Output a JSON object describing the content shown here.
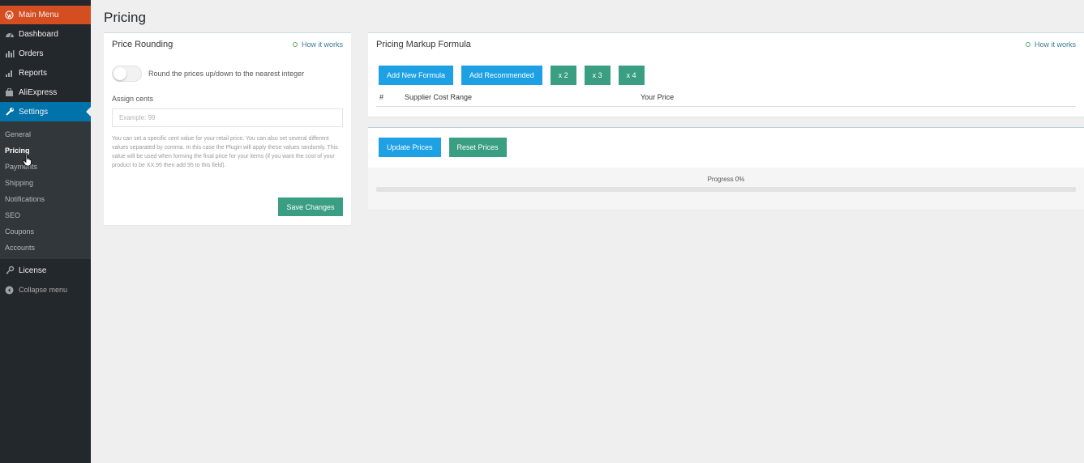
{
  "sidebar": {
    "main_menu": "Main Menu",
    "items": [
      {
        "label": "Dashboard",
        "icon": "dashboard-icon"
      },
      {
        "label": "Orders",
        "icon": "orders-icon"
      },
      {
        "label": "Reports",
        "icon": "reports-icon"
      },
      {
        "label": "AliExpress",
        "icon": "aliexpress-icon"
      },
      {
        "label": "Settings",
        "icon": "wrench-icon"
      }
    ],
    "submenu": [
      "General",
      "Pricing",
      "Payments",
      "Shipping",
      "Notifications",
      "SEO",
      "Coupons",
      "Accounts"
    ],
    "license": "License",
    "collapse": "Collapse menu"
  },
  "page": {
    "title": "Pricing"
  },
  "rounding": {
    "title": "Price Rounding",
    "how_it_works": "How it works",
    "toggle_label": "Round the prices up/down to the nearest integer",
    "assign_label": "Assign cents",
    "cents_placeholder": "Example: 99",
    "help_text": "You can set a specific cent value for your retail price. You can also set several different values separated by comma. In this case the Plugin will apply these values randomly. This value will be used when forming the final price for your items (if you want the cost of your product to be XX.95 then add 95 to this field).",
    "save_label": "Save Changes"
  },
  "markup": {
    "title": "Pricing Markup Formula",
    "how_it_works": "How it works",
    "buttons": {
      "add_new": "Add New Formula",
      "add_recommended": "Add Recommended",
      "x2": "x 2",
      "x3": "x 3",
      "x4": "x 4"
    },
    "columns": [
      "#",
      "Supplier Cost Range",
      "Your Price"
    ]
  },
  "update": {
    "update_label": "Update Prices",
    "reset_label": "Reset Prices",
    "progress_label": "Progress 0%",
    "progress_value": 0
  },
  "colors": {
    "sidebar_bg": "#23282d",
    "main_menu_bg": "#d54e21",
    "active_bg": "#0073aa",
    "green": "#3a9e82",
    "blue": "#1ea1e4"
  }
}
